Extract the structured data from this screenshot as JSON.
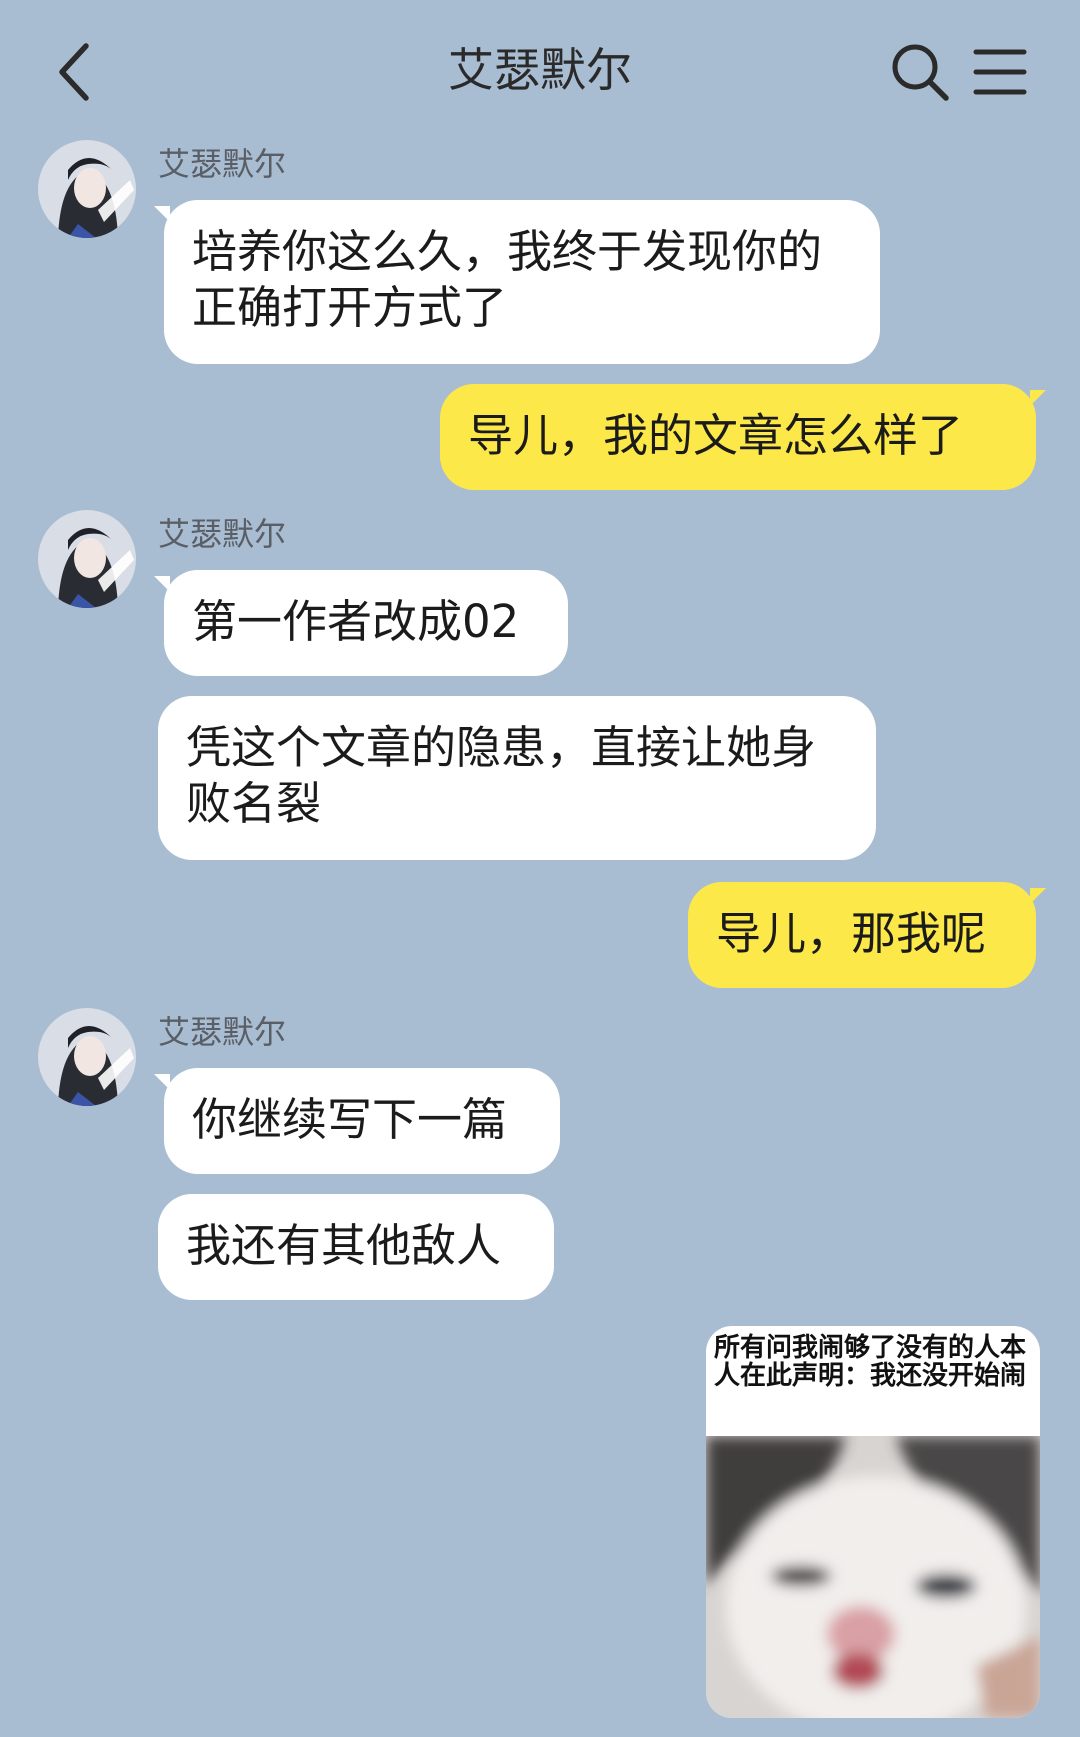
{
  "header": {
    "title": "艾瑟默尔",
    "back_icon": "chevron-left-icon",
    "search_icon": "search-icon",
    "menu_icon": "menu-icon"
  },
  "contact": {
    "name": "艾瑟默尔"
  },
  "messages": [
    {
      "sender": "艾瑟默尔",
      "text": "培养你这么久，我终于发现你的正确打开方式了"
    },
    {
      "sender": "me",
      "text": "导儿，我的文章怎么样了"
    },
    {
      "sender": "艾瑟默尔",
      "text": "第一作者改成02"
    },
    {
      "sender": "艾瑟默尔",
      "text": "凭这个文章的隐患，直接让她身败名裂"
    },
    {
      "sender": "me",
      "text": "导儿，那我呢"
    },
    {
      "sender": "艾瑟默尔",
      "text": "你继续写下一篇"
    },
    {
      "sender": "艾瑟默尔",
      "text": "我还有其他敌人"
    }
  ],
  "sticker": {
    "caption": "所有问我闹够了没有的人本人在此声明：我还没开始闹",
    "image": "kitten-face"
  },
  "colors": {
    "background": "#a9bdd2",
    "incoming_bubble": "#ffffff",
    "outgoing_bubble": "#fde84a"
  }
}
